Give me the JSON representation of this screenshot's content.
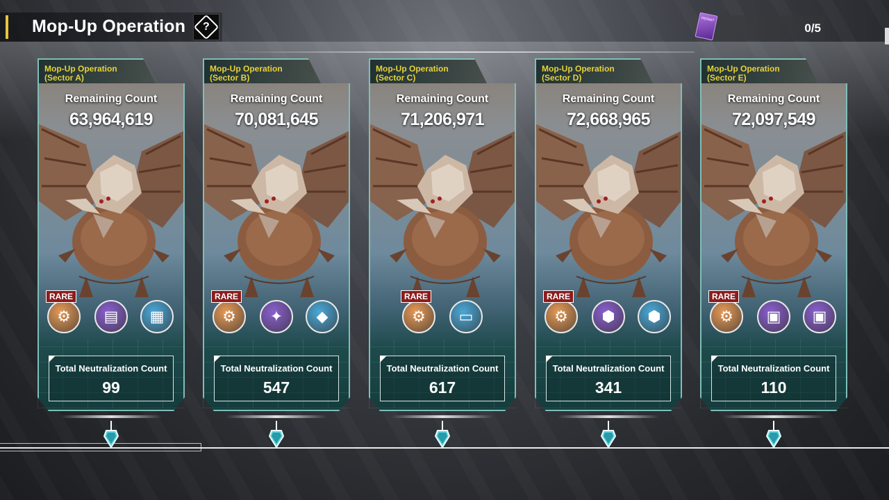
{
  "header": {
    "title": "Mop-Up Operation",
    "help_glyph": "?"
  },
  "permit": {
    "icon_text": "PERMIT",
    "count": "0/5"
  },
  "labels": {
    "remaining": "Remaining Count",
    "neutralization": "Total Neutralization Count",
    "rare": "RARE"
  },
  "cards": [
    {
      "title_line1": "Mop-Up Operation",
      "title_line2": "(Sector A)",
      "remaining": "63,964,619",
      "total": "99",
      "rewards": [
        {
          "icon": "gear-canister-icon",
          "color": "#e89a55",
          "rare": true
        },
        {
          "icon": "document-icon",
          "color": "#8a5fd0",
          "rare": false
        },
        {
          "icon": "blueprint-card-icon",
          "color": "#4aa8d8",
          "rare": false
        }
      ]
    },
    {
      "title_line1": "Mop-Up Operation",
      "title_line2": "(Sector B)",
      "remaining": "70,081,645",
      "total": "547",
      "rewards": [
        {
          "icon": "gear-canister-icon",
          "color": "#e89a55",
          "rare": true
        },
        {
          "icon": "crystal-icon",
          "color": "#8a5fd0",
          "rare": false
        },
        {
          "icon": "crystal-shard-icon",
          "color": "#4aa8d8",
          "rare": false
        }
      ]
    },
    {
      "title_line1": "Mop-Up Operation",
      "title_line2": "(Sector C)",
      "remaining": "71,206,971",
      "total": "617",
      "rewards": [
        {
          "icon": "gear-canister-icon",
          "color": "#e89a55",
          "rare": true
        },
        {
          "icon": "credit-card-icon",
          "color": "#4aa8d8",
          "rare": false
        }
      ]
    },
    {
      "title_line1": "Mop-Up Operation",
      "title_line2": "(Sector D)",
      "remaining": "72,668,965",
      "total": "341",
      "rewards": [
        {
          "icon": "gear-canister-icon",
          "color": "#e89a55",
          "rare": true
        },
        {
          "icon": "module-canister-icon",
          "color": "#8a5fd0",
          "rare": false
        },
        {
          "icon": "module-canister-icon",
          "color": "#4aa8d8",
          "rare": false
        }
      ]
    },
    {
      "title_line1": "Mop-Up Operation",
      "title_line2": "(Sector E)",
      "remaining": "72,097,549",
      "total": "110",
      "rewards": [
        {
          "icon": "gear-canister-icon",
          "color": "#e89a55",
          "rare": true
        },
        {
          "icon": "supply-chest-icon",
          "color": "#8a5fd0",
          "rare": false
        },
        {
          "icon": "supply-chest-icon",
          "color": "#8a5fd0",
          "rare": false
        }
      ]
    }
  ]
}
